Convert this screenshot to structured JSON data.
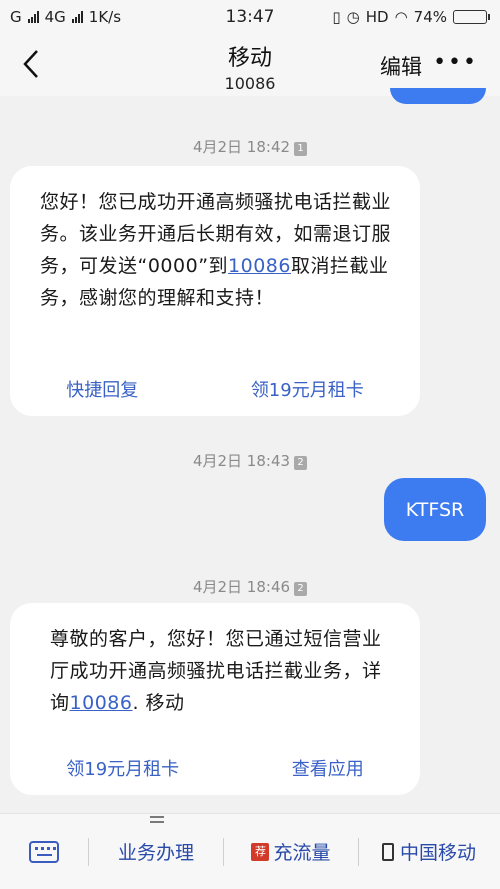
{
  "status_bar": {
    "carrier_1": "G",
    "carrier_2": "4G",
    "speed": "1K/s",
    "time": "13:47",
    "hd": "HD",
    "battery_percent": "74%",
    "battery_level": 0.74
  },
  "header": {
    "contact_name": "移动",
    "contact_number": "10086",
    "edit_label": "编辑",
    "more_label": "•••"
  },
  "messages": [
    {
      "timestamp": "4月2日 18:42",
      "sim": "1",
      "text_before": "您好！您已成功开通高频骚扰电话拦截业务。该业务开通后长期有效，如需退订服务，可发送“0000”到",
      "link": "10086",
      "text_after": "取消拦截业务，感谢您的理解和支持！",
      "actions": [
        "快捷回复",
        "领19元月租卡"
      ]
    },
    {
      "timestamp": "4月2日 18:43",
      "sim": "2",
      "outgoing_text": "KTFSR"
    },
    {
      "timestamp": "4月2日 18:46",
      "sim": "2",
      "text_before": "尊敬的客户，您好！您已通过短信营业厅成功开通高频骚扰电话拦截业务，详询",
      "link": "10086",
      "text_after": ". 移动",
      "actions": [
        "领19元月租卡",
        "查看应用"
      ]
    }
  ],
  "bottom_bar": {
    "menu_1": "业务办理",
    "menu_2_icon_text": "荐",
    "menu_2": "充流量",
    "menu_3": "中国移动"
  },
  "colors": {
    "accent_blue": "#3d7bf0",
    "link_blue": "#3a62c6",
    "background": "#f1f1f1"
  }
}
